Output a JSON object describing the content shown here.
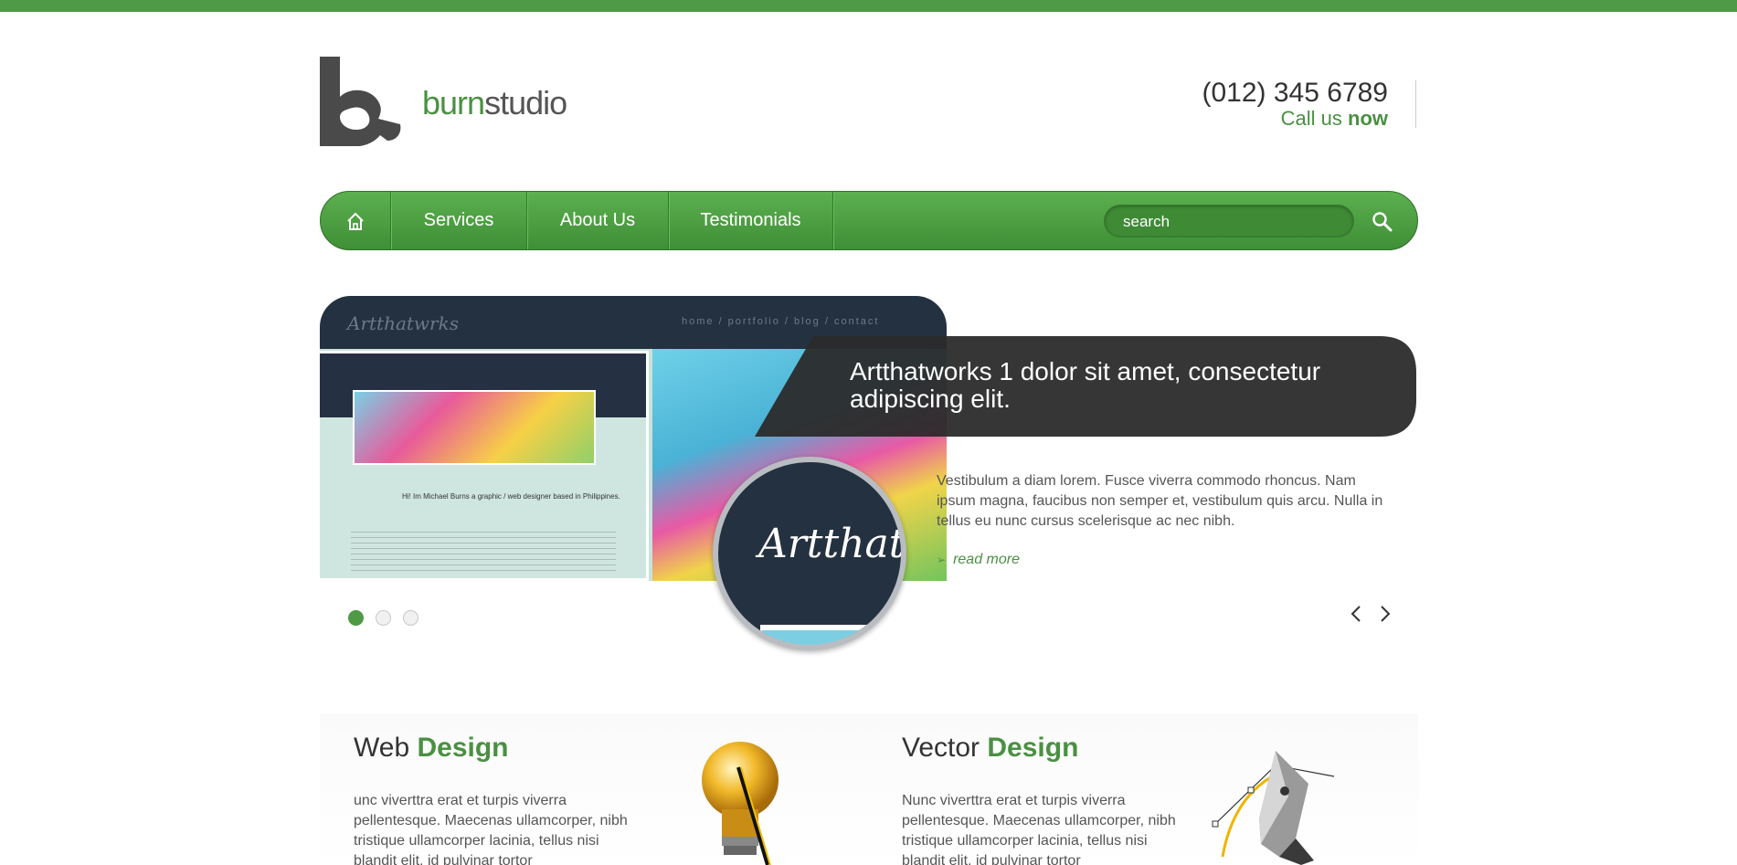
{
  "brand": {
    "name_light": "burn",
    "name_dark": "studio"
  },
  "contact": {
    "phone": "(012) 345 6789",
    "cta_prefix": "Call us ",
    "cta_bold": "now"
  },
  "nav": {
    "items": [
      {
        "label": "Services"
      },
      {
        "label": "About Us"
      },
      {
        "label": "Testimonials"
      }
    ],
    "search_placeholder": "search"
  },
  "slider": {
    "preview": {
      "site_title": "Artthatwrks",
      "links": "home / portfolio / blog / contact",
      "tagline": "Hi! Im Michael Burns a graphic / web designer based in Philippines.",
      "circle_text": "Artthatw"
    },
    "title": "Artthatworks 1 dolor sit amet, consectetur adipiscing elit.",
    "body": "Vestibulum a diam lorem. Fusce viverra commodo rhoncus. Nam ipsum magna, faucibus non semper et, vestibulum quis arcu. Nulla in tellus eu nunc cursus scelerisque ac nec nibh.",
    "read_more": "read more",
    "active_slide": 1,
    "slide_count": 3
  },
  "services": [
    {
      "title_plain": "Web ",
      "title_bold": "Design",
      "text": "unc viverttra erat et turpis viverra pellentesque. Maecenas ullamcorper, nibh tristique ullamcorper lacinia, tellus nisi blandit elit, id pulvinar tortor",
      "icon": "lightbulb-icon"
    },
    {
      "title_plain": "Vector ",
      "title_bold": "Design",
      "text": "Nunc viverttra erat et turpis viverra pellentesque. Maecenas ullamcorper, nibh tristique ullamcorper lacinia, tellus nisi blandit elit, id pulvinar tortor",
      "icon": "pen-nib-icon"
    }
  ],
  "colors": {
    "accent": "#4e9a47",
    "dark": "#333333"
  }
}
